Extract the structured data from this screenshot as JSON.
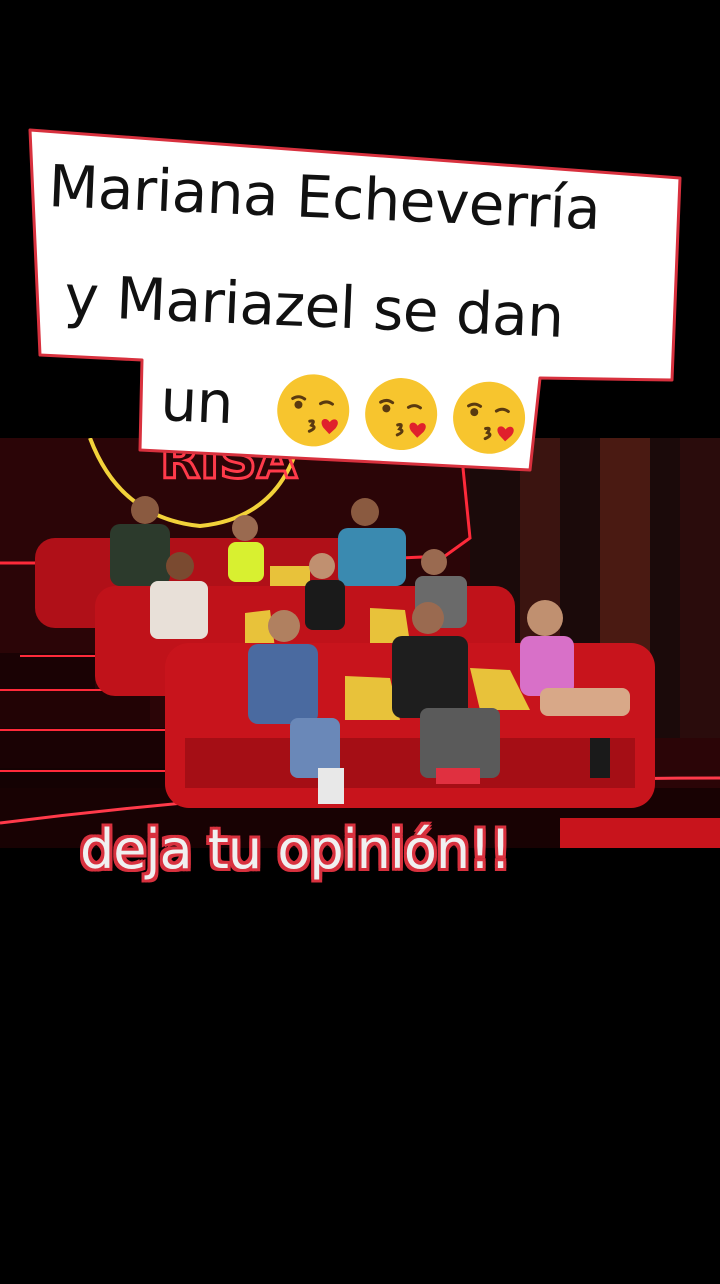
{
  "caption": {
    "line1": "Mariana Echeverría",
    "line2": "y Mariazel se dan",
    "line3": "un",
    "emoji_icons": [
      "kissing-face-heart-icon",
      "kissing-face-heart-icon",
      "kissing-face-heart-icon"
    ]
  },
  "scene": {
    "sign_text": "RISA"
  },
  "bottom_caption": "deja tu opinión!!",
  "colors": {
    "background": "#000000",
    "caption_card": "#ffffff",
    "caption_outline": "#d8313e",
    "sofa_red": "#c8141c",
    "cushion_yellow": "#e8c23a",
    "neon_red": "#ff2a3a",
    "neon_yellow": "#f2d23a"
  }
}
